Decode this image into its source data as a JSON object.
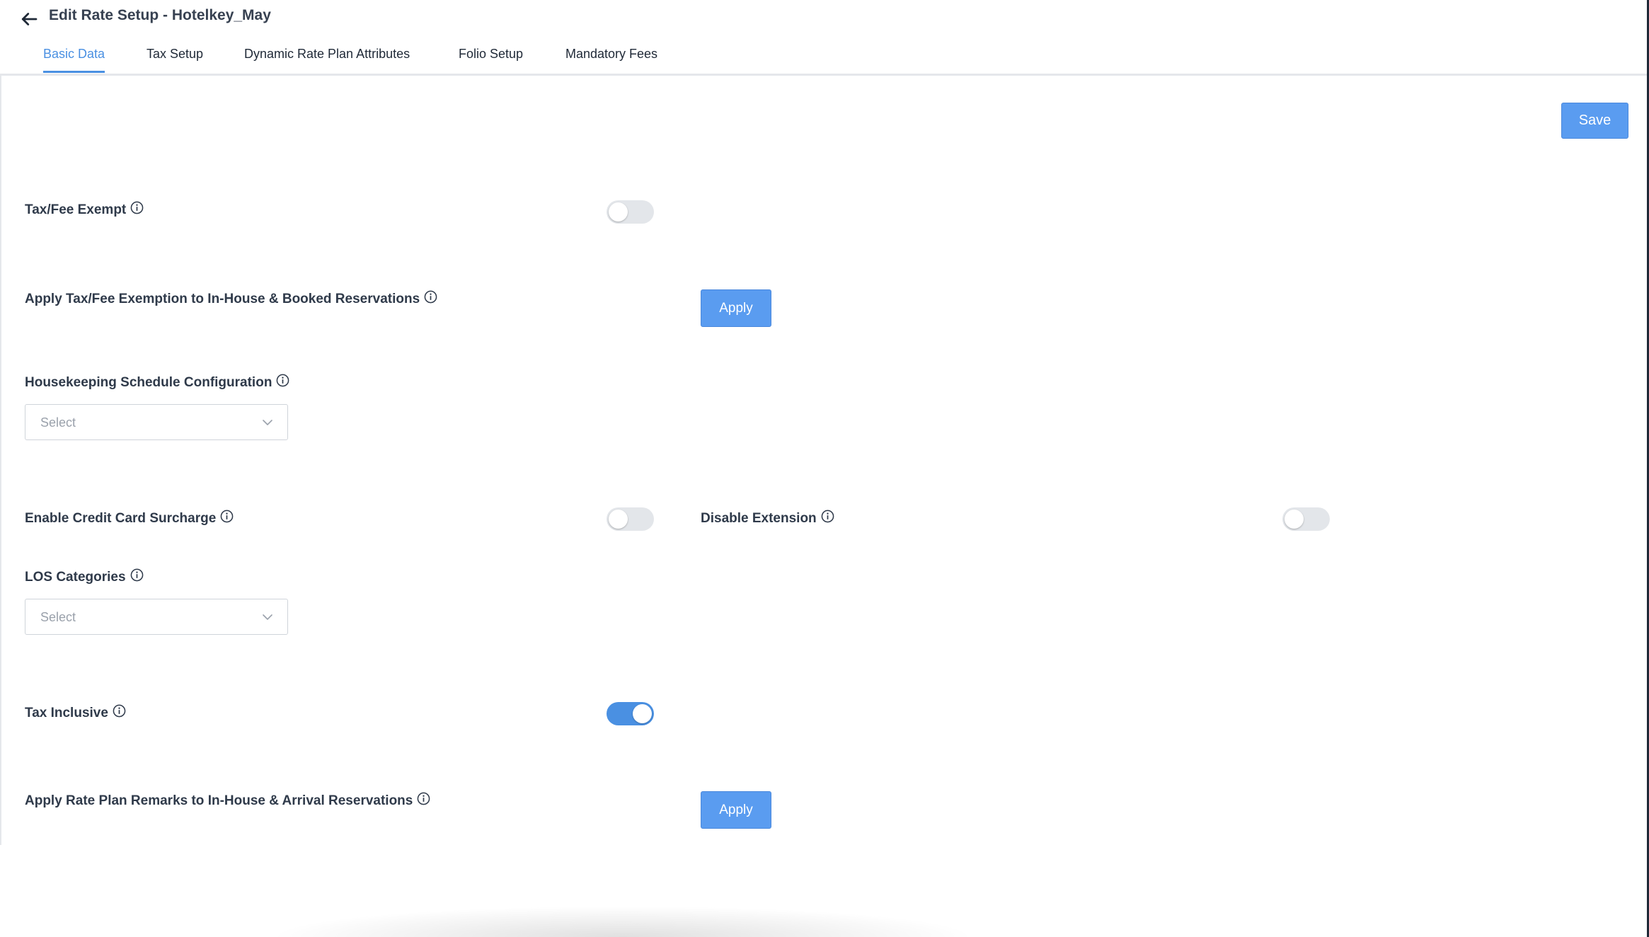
{
  "header": {
    "title": "Edit Rate Setup - Hotelkey_May",
    "tabs": [
      {
        "label": "Basic Data",
        "active": true
      },
      {
        "label": "Tax Setup",
        "active": false
      },
      {
        "label": "Dynamic Rate Plan Attributes",
        "active": false
      },
      {
        "label": "Folio Setup",
        "active": false
      },
      {
        "label": "Mandatory Fees",
        "active": false
      }
    ]
  },
  "toolbar": {
    "save_label": "Save"
  },
  "form": {
    "tax_fee_exempt": {
      "label": "Tax/Fee Exempt",
      "enabled": false
    },
    "apply_tax_fee_exemption": {
      "label": "Apply Tax/Fee Exemption to In-House & Booked Reservations",
      "button": "Apply"
    },
    "housekeeping_schedule": {
      "label": "Housekeeping Schedule Configuration",
      "placeholder": "Select"
    },
    "credit_card_surcharge": {
      "label": "Enable Credit Card Surcharge",
      "enabled": false
    },
    "disable_extension": {
      "label": "Disable Extension",
      "enabled": false
    },
    "los_categories": {
      "label": "LOS Categories",
      "placeholder": "Select"
    },
    "tax_inclusive": {
      "label": "Tax Inclusive",
      "enabled": true
    },
    "apply_rate_plan_remarks": {
      "label": "Apply Rate Plan Remarks to In-House & Arrival Reservations",
      "button": "Apply"
    }
  },
  "colors": {
    "accent": "#4a90e2",
    "button": "#5a9cf0",
    "toggle_off": "#e3e6ea"
  },
  "icons": [
    "back-arrow-icon",
    "info-icon",
    "chevron-down-icon"
  ]
}
